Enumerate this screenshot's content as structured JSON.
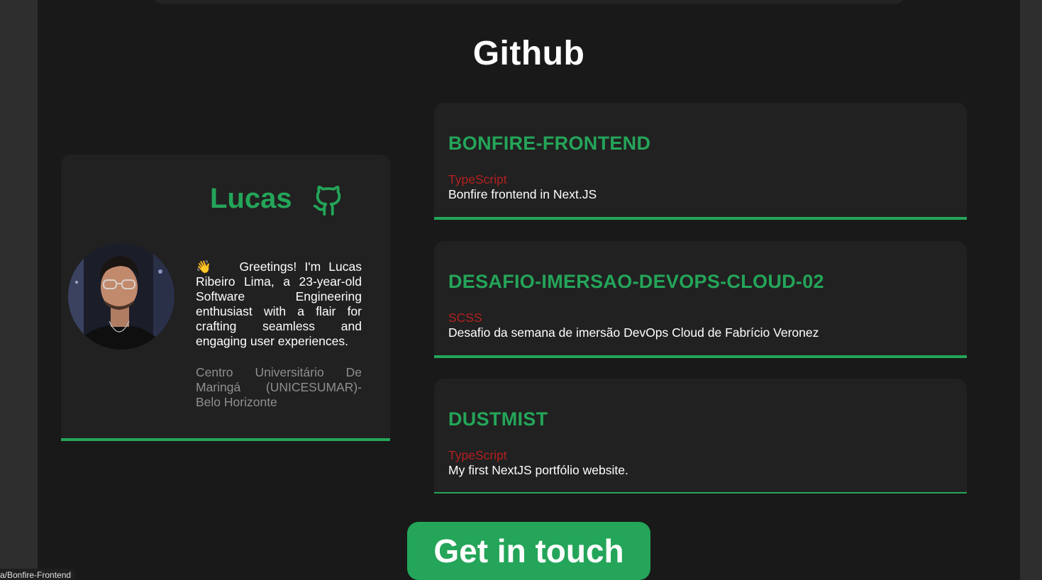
{
  "section": {
    "title": "Github"
  },
  "profile": {
    "name": "Lucas",
    "wave_emoji": "👋",
    "bio": "Greetings! I'm Lucas Ribeiro Lima, a 23-year-old Software Engineering enthusiast with a flair for crafting seamless and engaging user experiences.",
    "school": "Centro Universitário De Maringá (UNICESUMAR)- Belo Horizonte",
    "icon": "github-icon"
  },
  "repos": [
    {
      "name": "BONFIRE-FRONTEND",
      "language": "TypeScript",
      "description": "Bonfire frontend in Next.JS"
    },
    {
      "name": "DESAFIO-IMERSAO-DEVOPS-CLOUD-02",
      "language": "SCSS",
      "description": "Desafio da semana de imersão DevOps Cloud de Fabrício Veronez"
    },
    {
      "name": "DUSTMIST",
      "language": "TypeScript",
      "description": "My first NextJS portfólio website."
    }
  ],
  "cta": {
    "label": "Get in touch"
  },
  "status_bar": {
    "url": "a/Bonfire-Frontend"
  },
  "colors": {
    "accent": "#24a559",
    "language": "#b3201f",
    "background": "#191919",
    "card": "#212121"
  }
}
